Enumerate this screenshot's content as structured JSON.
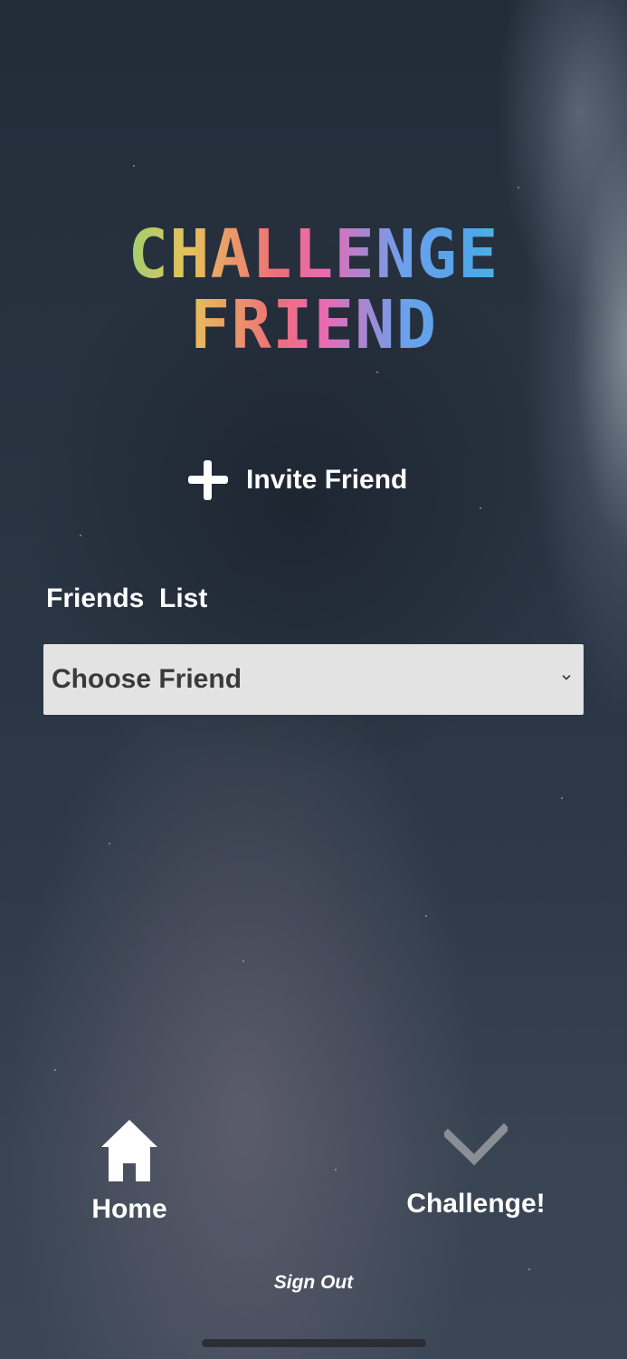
{
  "title": {
    "line1": "CHALLENGE",
    "line2": "FRIEND"
  },
  "invite": {
    "icon": "plus-icon",
    "label": "Invite Friend"
  },
  "friends_list": {
    "label": "Friends  List",
    "select": {
      "value": "Choose Friend",
      "icon": "chevron-down-icon"
    }
  },
  "nav": {
    "home": {
      "label": "Home",
      "icon": "home-icon"
    },
    "challenge": {
      "label": "Challenge!",
      "icon": "check-icon"
    }
  },
  "sign_out": "Sign Out",
  "colors": {
    "select_bg": "#e3e3e4",
    "select_text": "#3a3a3a",
    "check_icon": "#8a8f96"
  }
}
